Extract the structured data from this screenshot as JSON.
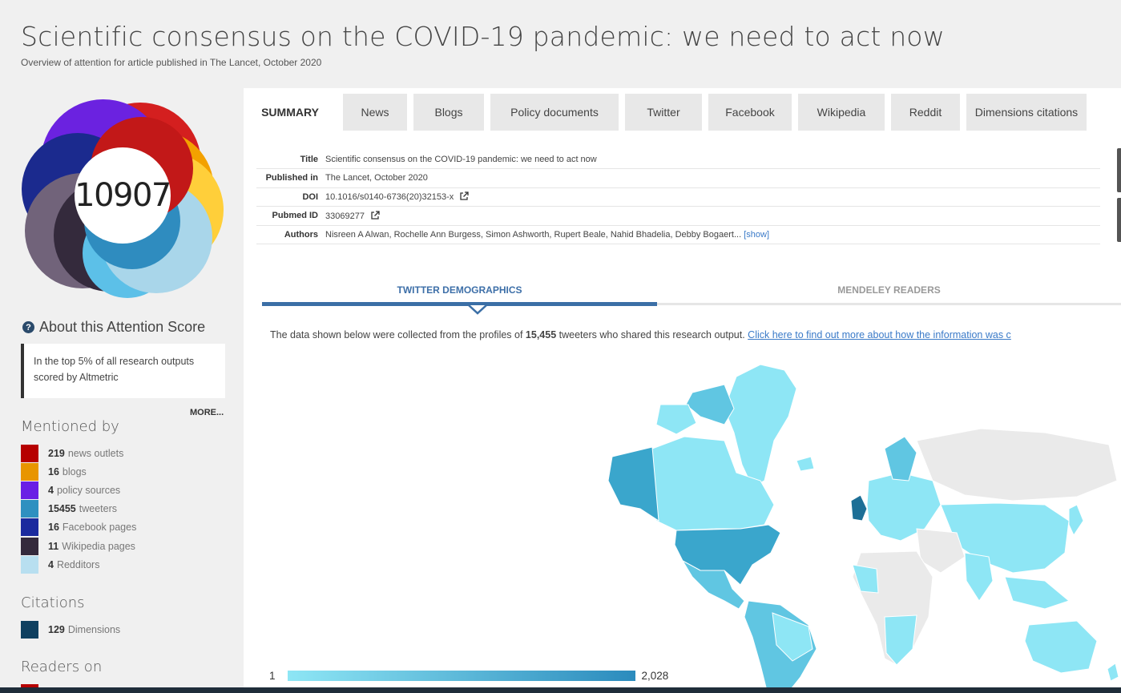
{
  "header": {
    "title": "Scientific consensus on the COVID-19 pandemic: we need to act now",
    "subtitle": "Overview of attention for article published in The Lancet, October 2020"
  },
  "score": {
    "value": "10907",
    "donut_colors": [
      "#e8b000",
      "#f3a100",
      "#d41f1f",
      "#8c1a8c",
      "#6b22e0",
      "#1b2a8e",
      "#1f4aa8",
      "#71637a",
      "#3a2d45",
      "#2f8cbf",
      "#5cc0e8",
      "#a9d6ea"
    ]
  },
  "about": {
    "label": "About this Attention Score",
    "text": "In the top 5% of all research outputs scored by Altmetric",
    "more": "MORE..."
  },
  "mentioned_by": {
    "heading": "Mentioned by",
    "items": [
      {
        "count": "219",
        "label": "news outlets",
        "color": "#b60000"
      },
      {
        "count": "16",
        "label": "blogs",
        "color": "#e89500"
      },
      {
        "count": "4",
        "label": "policy sources",
        "color": "#6a1fe5"
      },
      {
        "count": "15455",
        "label": "tweeters",
        "color": "#2f90c0"
      },
      {
        "count": "16",
        "label": "Facebook pages",
        "color": "#1b2a9e"
      },
      {
        "count": "11",
        "label": "Wikipedia pages",
        "color": "#342a3c"
      },
      {
        "count": "4",
        "label": "Redditors",
        "color": "#b8dff0"
      }
    ]
  },
  "citations": {
    "heading": "Citations",
    "items": [
      {
        "count": "129",
        "label": "Dimensions",
        "color": "#0f4060"
      }
    ]
  },
  "readers": {
    "heading": "Readers on",
    "first_color": "#b60000"
  },
  "tabs": [
    {
      "label": "SUMMARY",
      "active": true
    },
    {
      "label": "News"
    },
    {
      "label": "Blogs"
    },
    {
      "label": "Policy documents"
    },
    {
      "label": "Twitter"
    },
    {
      "label": "Facebook"
    },
    {
      "label": "Wikipedia"
    },
    {
      "label": "Reddit"
    },
    {
      "label": "Dimensions citations"
    }
  ],
  "info": {
    "title_label": "Title",
    "title_value": "Scientific consensus on the COVID-19 pandemic: we need to act now",
    "published_label": "Published in",
    "published_value": "The Lancet, October 2020",
    "doi_label": "DOI",
    "doi_value": "10.1016/s0140-6736(20)32153-x",
    "pubmed_label": "Pubmed ID",
    "pubmed_value": "33069277",
    "authors_label": "Authors",
    "authors_value": "Nisreen A Alwan, Rochelle Ann Burgess, Simon Ashworth, Rupert Beale, Nahid Bhadelia, Debby Bogaert...",
    "show_link": "[show]"
  },
  "subtabs": {
    "twitter": "TWITTER DEMOGRAPHICS",
    "mendeley": "MENDELEY READERS"
  },
  "description": {
    "prefix": "The data shown below were collected from the profiles of ",
    "count": "15,455",
    "suffix": " tweeters who shared this research output. ",
    "link": "Click here to find out more about how the information was c"
  },
  "map": {
    "colors": {
      "low": "#8ee6f5",
      "mid": "#60c6e2",
      "high": "#3aa6cc",
      "top": "#1d6f96",
      "none": "#eaeaea"
    }
  },
  "legend": {
    "min": "1",
    "max": "2,028"
  }
}
